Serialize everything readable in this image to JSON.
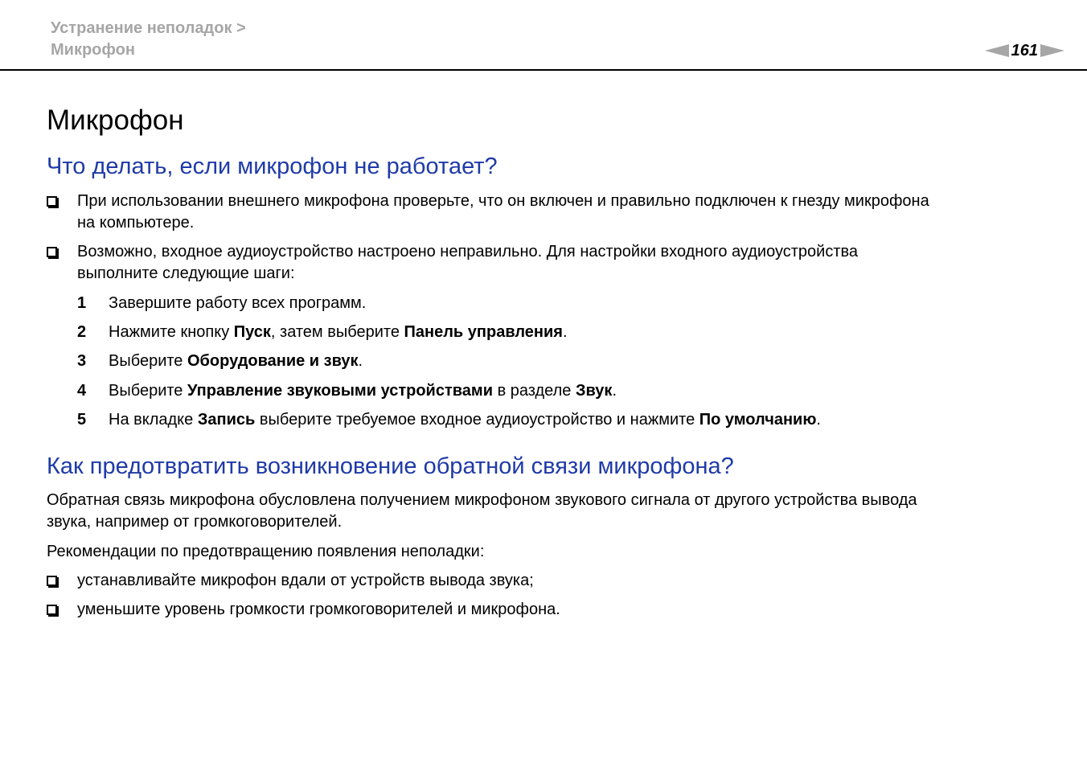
{
  "header": {
    "breadcrumb_line1": "Устранение неполадок >",
    "breadcrumb_line2": "Микрофон",
    "page_number": "161"
  },
  "main": {
    "title": "Микрофон",
    "section1": {
      "heading": "Что делать, если микрофон не работает?",
      "bullets": [
        {
          "line1": "При использовании внешнего микрофона проверьте, что он включен и правильно подключен к гнезду микрофона",
          "line2": "на компьютере."
        },
        {
          "line1": "Возможно, входное аудиоустройство настроено неправильно. Для настройки входного аудиоустройства",
          "line2": "выполните следующие шаги:"
        }
      ],
      "steps": [
        {
          "num": "1",
          "parts": [
            "Завершите работу всех программ."
          ]
        },
        {
          "num": "2",
          "parts": [
            "Нажмите кнопку ",
            "Пуск",
            ", затем выберите ",
            "Панель управления",
            "."
          ]
        },
        {
          "num": "3",
          "parts": [
            "Выберите ",
            "Оборудование и звук",
            "."
          ]
        },
        {
          "num": "4",
          "parts": [
            "Выберите ",
            "Управление звуковыми устройствами",
            " в разделе ",
            "Звук",
            "."
          ]
        },
        {
          "num": "5",
          "parts": [
            "На вкладке ",
            "Запись",
            " выберите требуемое входное аудиоустройство и нажмите ",
            "По умолчанию",
            "."
          ]
        }
      ]
    },
    "section2": {
      "heading": "Как предотвратить возникновение обратной связи микрофона?",
      "para1_line1": "Обратная связь микрофона обусловлена получением микрофоном звукового сигнала от другого устройства вывода",
      "para1_line2": "звука, например от громкоговорителей.",
      "para2": "Рекомендации по предотвращению появления неполадки:",
      "bullets": [
        "устанавливайте микрофон вдали от устройств вывода звука;",
        "уменьшите уровень громкости громкоговорителей и микрофона."
      ]
    }
  },
  "colors": {
    "heading": "#1f3aa8",
    "header_gray": "#a6a6a6"
  }
}
